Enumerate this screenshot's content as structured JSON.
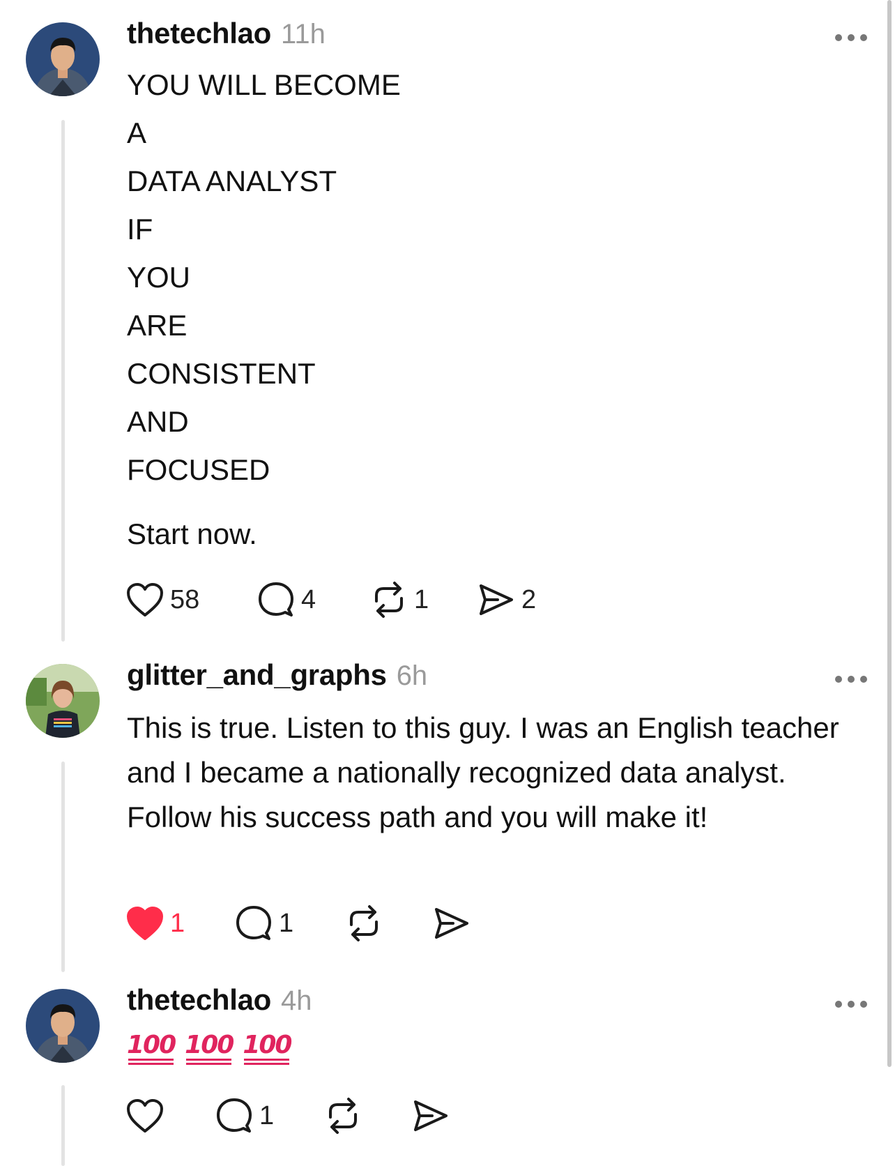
{
  "posts": [
    {
      "username": "thetechlao",
      "time": "11h",
      "lines": [
        "YOU WILL BECOME",
        "A",
        "DATA ANALYST",
        "IF",
        "YOU",
        "ARE",
        "CONSISTENT",
        "AND",
        "FOCUSED"
      ],
      "closing": "Start now.",
      "likes": "58",
      "comments": "4",
      "reposts": "1",
      "shares": "2",
      "liked": false
    },
    {
      "username": "glitter_and_graphs",
      "time": "6h",
      "text": "This is true. Listen to this guy. I was an English teacher and I became a nationally recognized data analyst. Follow his success path and you will make it!",
      "likes": "1",
      "comments": "1",
      "liked": true
    },
    {
      "username": "thetechlao",
      "time": "4h",
      "emoji": [
        "100",
        "100",
        "100"
      ],
      "comments": "1",
      "liked": false
    }
  ],
  "colors": {
    "like_red": "#ff2d4a",
    "icon": "#1a1a1a",
    "muted": "#9a9a9a",
    "thread_line": "#e3e3e3"
  },
  "icons": {
    "like": "heart-icon",
    "comment": "comment-bubble-icon",
    "repost": "repost-icon",
    "share": "send-icon",
    "more": "more-dots-icon"
  }
}
